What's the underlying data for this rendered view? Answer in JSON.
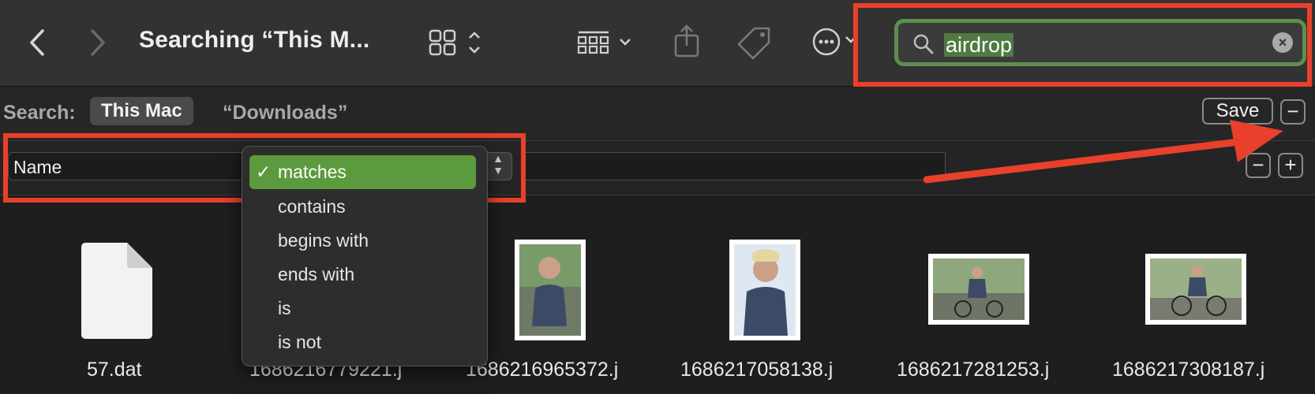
{
  "toolbar": {
    "title": "Searching “This M...",
    "icons": [
      "back-icon",
      "forward-icon",
      "icon-view-icon",
      "group-icon",
      "share-icon",
      "tag-icon",
      "more-icon"
    ],
    "search": {
      "value": "airdrop",
      "icon": "magnifier-icon",
      "clear_icon": "clear-icon"
    }
  },
  "scope_bar": {
    "label": "Search:",
    "this_mac": "This Mac",
    "downloads": "“Downloads”",
    "save": "Save",
    "remove": "−"
  },
  "criteria": {
    "attribute": "Name",
    "operator_options": [
      "matches",
      "contains",
      "begins with",
      "ends with",
      "is",
      "is not"
    ],
    "selected_operator": "matches",
    "check": "✓",
    "remove": "−",
    "add": "+"
  },
  "files": [
    {
      "name": "57.dat",
      "kind": "document-icon"
    },
    {
      "name": "1686216779221.j",
      "kind": "image-thumbnail"
    },
    {
      "name": "1686216965372.j",
      "kind": "image-thumbnail"
    },
    {
      "name": "1686217058138.j",
      "kind": "image-thumbnail"
    },
    {
      "name": "1686217281253.j",
      "kind": "image-thumbnail"
    },
    {
      "name": "1686217308187.j",
      "kind": "image-thumbnail"
    }
  ],
  "colors": {
    "annotation_red": "#e8402a",
    "search_highlight": "#5f8f4f",
    "menu_selected": "#5c9a3e"
  }
}
